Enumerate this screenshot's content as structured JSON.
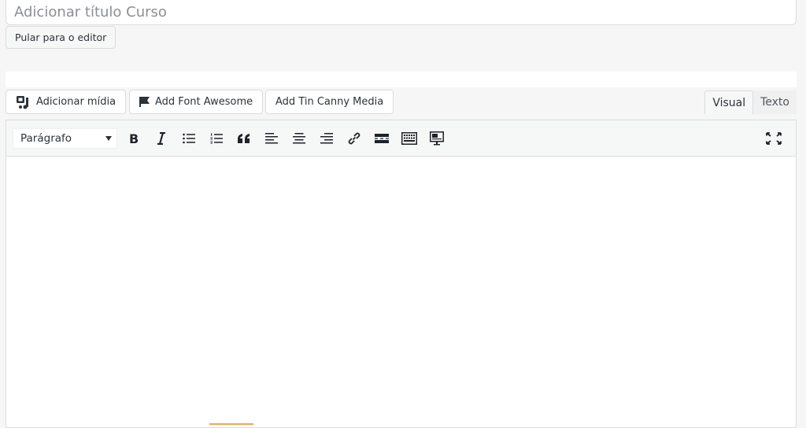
{
  "title_field": {
    "placeholder": "Adicionar título Curso",
    "value": ""
  },
  "skip_button": {
    "label": "Pular para o editor"
  },
  "media_buttons": {
    "add_media": "Adicionar mídia",
    "font_awesome": "Add Font Awesome",
    "tin_canny": "Add Tin Canny Media"
  },
  "mode_tabs": {
    "visual": "Visual",
    "text": "Texto",
    "active": "Visual"
  },
  "toolbar": {
    "format_select": "Parágrafo",
    "buttons": [
      "bold-icon",
      "italic-icon",
      "bullet-list-icon",
      "numbered-list-icon",
      "blockquote-icon",
      "align-left-icon",
      "align-center-icon",
      "align-right-icon",
      "link-icon",
      "read-more-icon",
      "toolbar-toggle-icon",
      "slideshow-icon"
    ],
    "fullscreen_icon": "fullscreen-icon"
  },
  "colors": {
    "accent_orange": "#f0a64a",
    "border": "#dcdcde",
    "toolbar_bg": "#f6f7f7"
  }
}
